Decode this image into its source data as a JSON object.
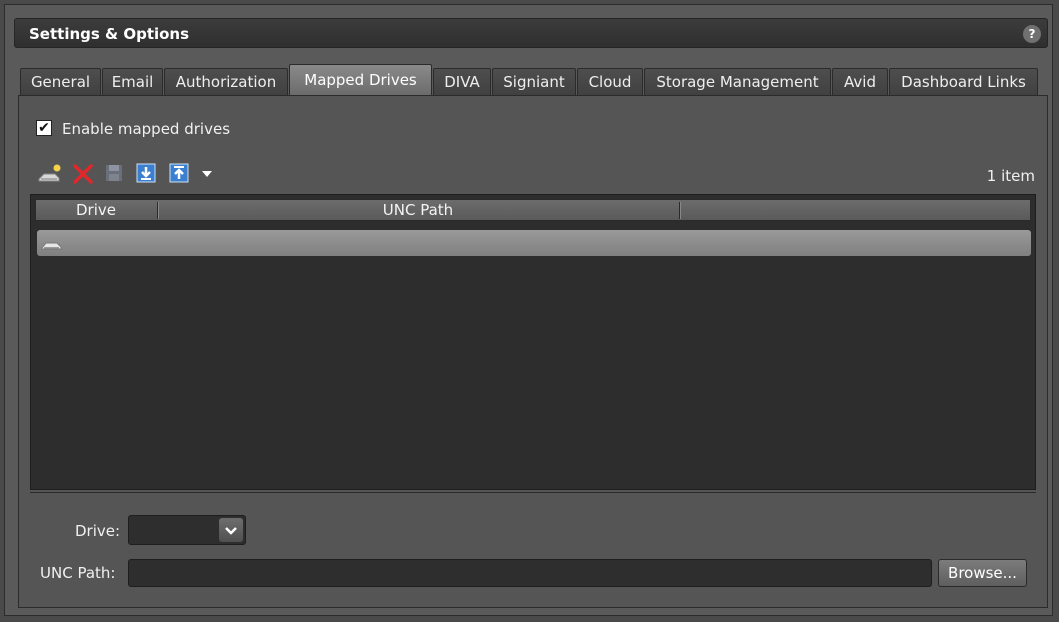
{
  "window": {
    "title": "Settings & Options",
    "help_label": "?"
  },
  "tabs": [
    {
      "label": "General"
    },
    {
      "label": "Email"
    },
    {
      "label": "Authorization"
    },
    {
      "label": "Mapped Drives",
      "active": true
    },
    {
      "label": "DIVA"
    },
    {
      "label": "Signiant"
    },
    {
      "label": "Cloud"
    },
    {
      "label": "Storage Management"
    },
    {
      "label": "Avid"
    },
    {
      "label": "Dashboard Links"
    }
  ],
  "mapped_drives": {
    "enable_checkbox": {
      "label": "Enable mapped drives",
      "checked": true
    },
    "toolbar": {
      "icons": [
        "add-drive-icon",
        "delete-icon",
        "save-icon",
        "import-icon",
        "export-icon",
        "dropdown-arrow-icon"
      ],
      "item_count": "1 item"
    },
    "grid": {
      "columns": [
        "Drive",
        "UNC Path",
        ""
      ],
      "rows": [
        {
          "drive": "",
          "unc_path": "",
          "icon": "drive-icon"
        }
      ]
    },
    "editor": {
      "drive_label": "Drive:",
      "drive_value": "",
      "unc_label": "UNC Path:",
      "unc_value": "",
      "browse_label": "Browse..."
    }
  },
  "colors": {
    "accent_red": "#e0282a",
    "accent_blue": "#3a7fd0"
  }
}
